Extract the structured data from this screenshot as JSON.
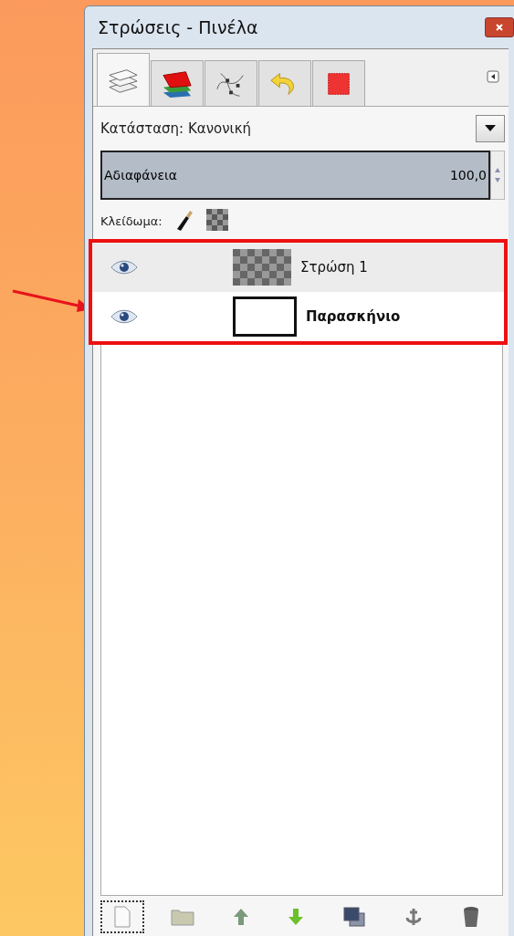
{
  "window": {
    "title": "Στρώσεις - Πινέλα"
  },
  "tabs": [
    {
      "kind": "layers",
      "selected": true
    },
    {
      "kind": "channels",
      "selected": false
    },
    {
      "kind": "paths",
      "selected": false
    },
    {
      "kind": "undo",
      "selected": false
    },
    {
      "kind": "selection",
      "selected": false
    }
  ],
  "mode": {
    "label": "Κατάσταση: Κανονική"
  },
  "opacity": {
    "label": "Αδιαφάνεια",
    "value": "100,0",
    "level": 1.0
  },
  "lock": {
    "label": "Κλείδωμα:"
  },
  "layers": [
    {
      "name": "Στρώση 1",
      "visible": true,
      "selected": true,
      "transparent": true
    },
    {
      "name": "Παρασκήνιο",
      "visible": true,
      "selected": false,
      "transparent": false
    }
  ],
  "highlighted": true
}
